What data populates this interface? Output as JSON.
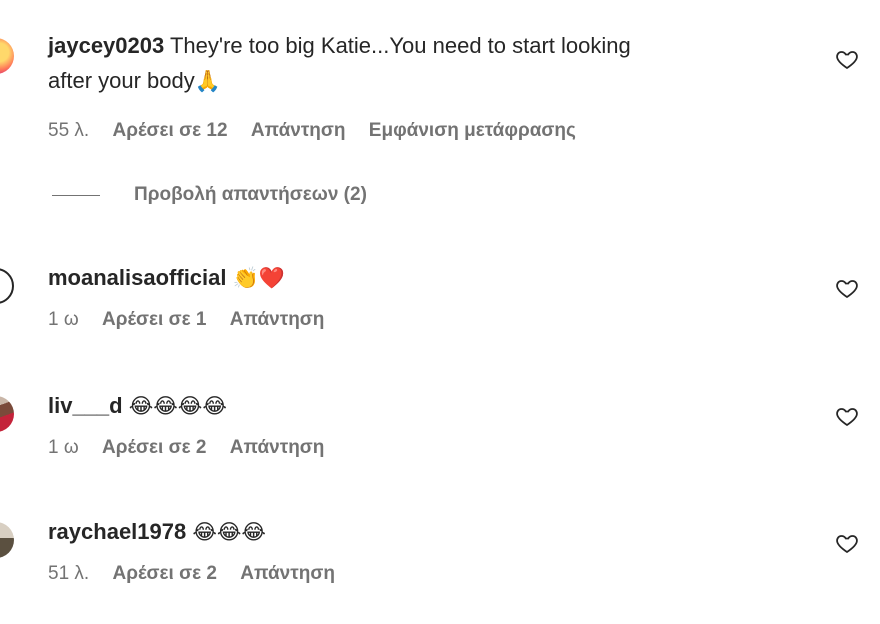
{
  "comments": [
    {
      "username": "jaycey0203",
      "text_line1": "They're too big Katie...You need to start looking",
      "text_line2": "after your body",
      "emoji": "🙏",
      "time": "55 λ.",
      "likes": "Αρέσει σε 12",
      "reply": "Απάντηση",
      "translate": "Εμφάνιση μετάφρασης",
      "view_replies": "Προβολή απαντήσεων (2)"
    },
    {
      "username": "moanalisaofficial",
      "emoji": "👏❤️",
      "time": "1 ω",
      "likes": "Αρέσει σε 1",
      "reply": "Απάντηση"
    },
    {
      "username": "liv___d",
      "emoji": "😂😂😂😂",
      "time": "1 ω",
      "likes": "Αρέσει σε 2",
      "reply": "Απάντηση"
    },
    {
      "username": "raychael1978",
      "emoji": "😂😂😂",
      "time": "51 λ.",
      "likes": "Αρέσει σε 2",
      "reply": "Απάντηση"
    }
  ],
  "icons": {
    "like": "heart-outline-icon"
  },
  "colors": {
    "text": "#262626",
    "secondary": "#737373"
  }
}
